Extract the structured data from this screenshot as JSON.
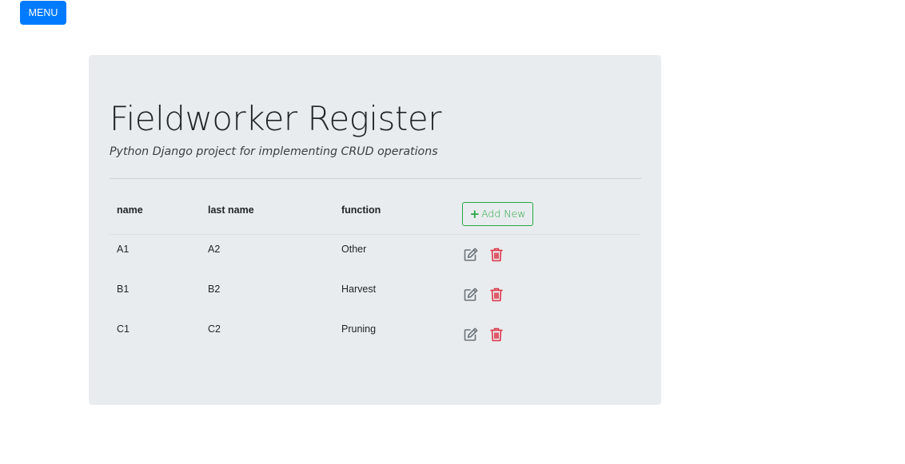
{
  "menu": {
    "label": "MENU"
  },
  "jumbotron": {
    "title": "Fieldworker Register",
    "subtitle": "Python Django project for implementing CRUD operations"
  },
  "table": {
    "headers": {
      "name": "name",
      "last_name": "last name",
      "function": "function"
    },
    "add_button": {
      "icon": "plus-icon",
      "label": "Add New"
    },
    "rows": [
      {
        "name": "A1",
        "last_name": "A2",
        "function": "Other"
      },
      {
        "name": "B1",
        "last_name": "B2",
        "function": "Harvest"
      },
      {
        "name": "C1",
        "last_name": "C2",
        "function": "Pruning"
      }
    ],
    "row_actions": {
      "edit_icon": "edit-icon",
      "delete_icon": "trash-icon"
    }
  },
  "colors": {
    "primary": "#007bff",
    "success": "#28a745",
    "danger": "#dc3545",
    "jumbotron_bg": "#e9ecef",
    "edit_icon": "#6c757d"
  }
}
